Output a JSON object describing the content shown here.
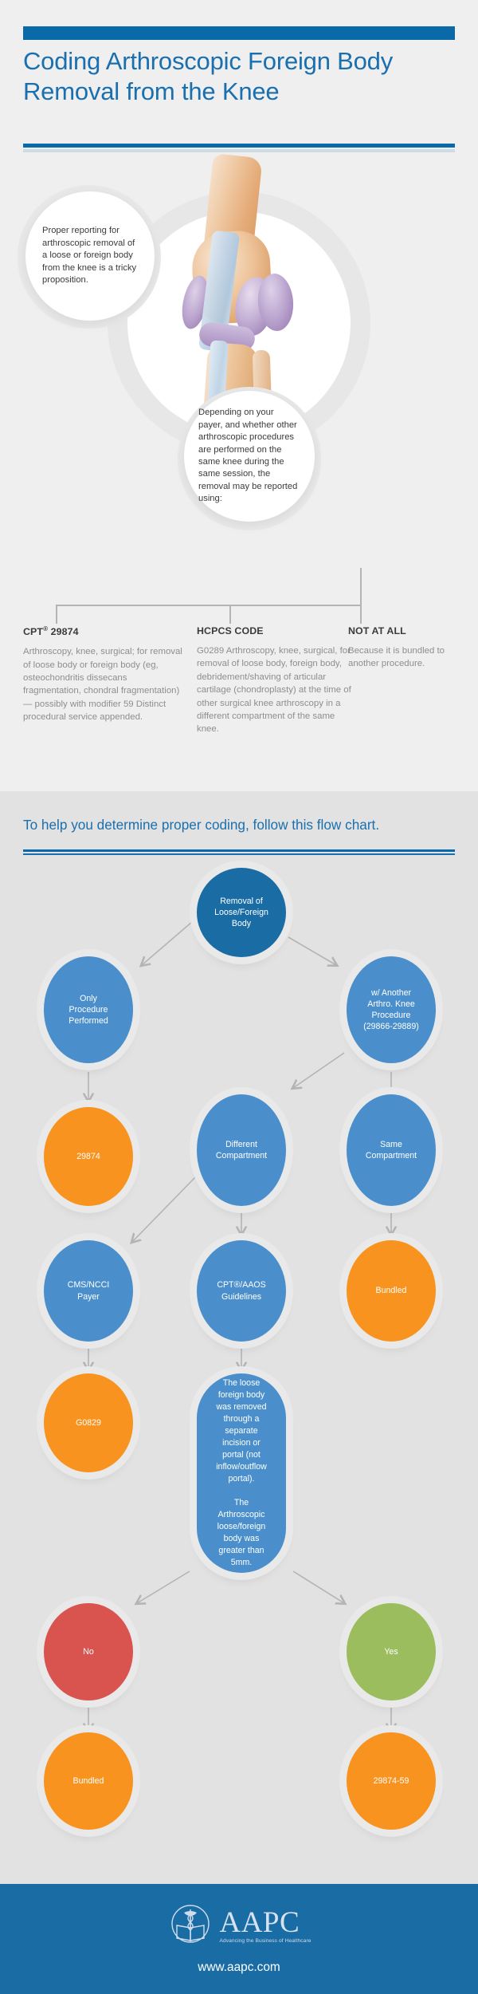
{
  "header": {
    "title": "Coding Arthroscopic Foreign Body Removal from the Knee"
  },
  "hero": {
    "bubble1": "Proper reporting for arthroscopic removal of a loose or foreign body from the knee is a tricky proposition.",
    "bubble2": "Depending on your payer, and whether other arthroscopic procedures are performed on the same knee during the same session, the removal may be reported using:",
    "illustration_name": "knee-anatomy-illustration"
  },
  "codes": [
    {
      "heading": "CPT",
      "heading_sup": "®",
      "heading_rest": " 29874",
      "body": "Arthroscopy, knee, surgical; for removal of loose body or foreign body (eg, osteochondritis dissecans fragmentation, chondral fragmentation) — possibly with modifier 59 Distinct procedural service appended."
    },
    {
      "heading": "HCPCS CODE",
      "heading_sup": "",
      "heading_rest": "",
      "body": "G0289 Arthroscopy, knee, surgical, for removal of loose body, foreign body, debridement/shaving of articular cartilage (chondroplasty) at the time of other surgical knee arthroscopy in a different compartment of the same knee."
    },
    {
      "heading": "NOT AT ALL",
      "heading_sup": "",
      "heading_rest": "",
      "body": "Because it is bundled to another procedure."
    }
  ],
  "flow": {
    "title": "To help you determine proper coding, follow this flow chart.",
    "nodes": {
      "root": "Removal of\nLoose/Foreign\nBody",
      "only_procedure": "Only\nProcedure\nPerformed",
      "another_arthro": "w/ Another\nArthro. Knee\nProcedure\n(29866-29889)",
      "code_29874": "29874",
      "different_compartment": "Different\nCompartment",
      "same_compartment": "Same\nCompartment",
      "cms_ncci": "CMS/NCCI\nPayer",
      "cpt_aaos": "CPT®/AAOS\nGuidelines",
      "bundled_right": "Bundled",
      "code_g0829": "G0829",
      "criteria": "The loose\nforeign body\nwas removed\nthrough a\nseparate\nincision or\nportal (not\ninflow/outflow\nportal).\n\nThe\nArthroscopic\nloose/foreign\nbody was\ngreater than\n5mm.",
      "no": "No",
      "yes": "Yes",
      "bundled_bottom": "Bundled",
      "code_29874_59": "29874-59"
    }
  },
  "footer": {
    "logo_text": "AAPC",
    "logo_tagline": "Advancing the Business of Healthcare",
    "url": "www.aapc.com"
  },
  "colors": {
    "page_bg": "#efefef",
    "flow_bg": "#e2e2e2",
    "brand_blue": "#0a69a8",
    "title_blue": "#1a6fae",
    "node_dark_blue": "#1a6ca5",
    "node_blue": "#4a8fcb",
    "node_orange": "#f7931e",
    "node_red": "#d9534f",
    "node_green": "#9bbd5e",
    "body_gray": "#8e8e8e",
    "arrow_gray": "#b4b4b4"
  }
}
